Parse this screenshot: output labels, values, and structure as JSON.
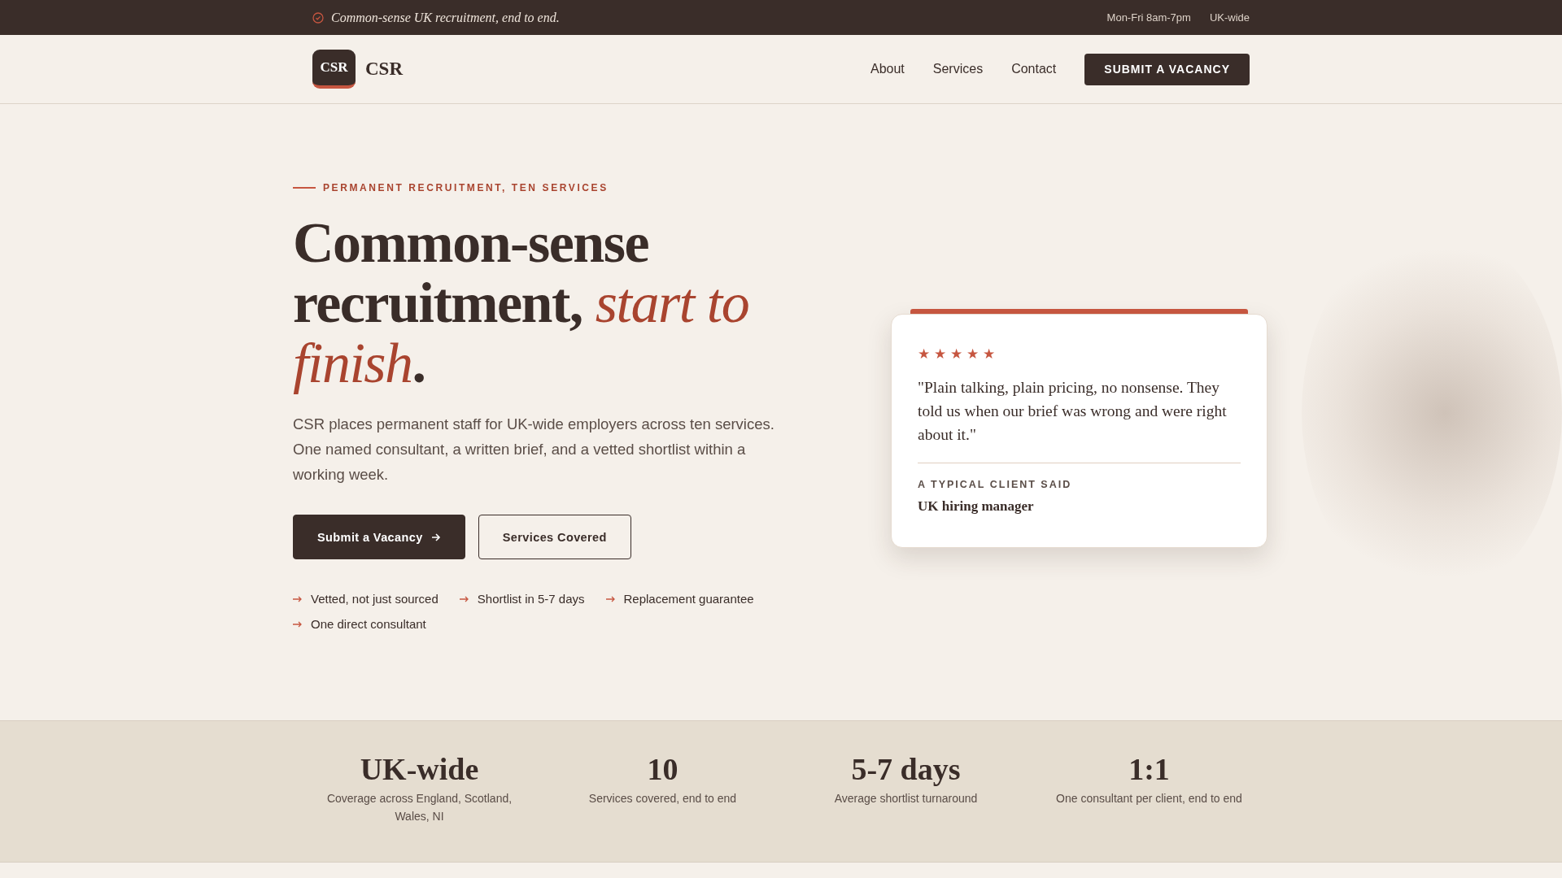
{
  "top_bar": {
    "tagline": "Common-sense UK recruitment, end to end.",
    "hours": "Mon-Fri 8am-7pm",
    "coverage": "UK-wide"
  },
  "nav": {
    "logo_badge": "CSR",
    "logo_text": "CSR",
    "links": [
      "About",
      "Services",
      "Contact"
    ],
    "cta": "SUBMIT A VACANCY"
  },
  "hero": {
    "eyebrow": "PERMANENT RECRUITMENT, TEN SERVICES",
    "headline": "Common-sense recruitment, *start to finish*.",
    "intro": "CSR places permanent staff for UK-wide employers across ten services. One named consultant, a written brief, and a vetted shortlist within a working week.",
    "buttons": [
      {
        "label": "Submit a Vacancy",
        "kind": "primary"
      },
      {
        "label": "Services Covered",
        "kind": "secondary"
      }
    ],
    "points": [
      "Vetted, not just sourced",
      "Shortlist in 5-7 days",
      "Replacement guarantee",
      "One direct consultant"
    ]
  },
  "testimonial": {
    "stars": 5,
    "quote": "\"Plain talking, plain pricing, no nonsense. They told us when our brief was wrong and were right about it.\"",
    "label": "A TYPICAL CLIENT SAID",
    "author": "UK hiring manager"
  },
  "stats": [
    {
      "value": "UK-wide",
      "caption": "Coverage across England, Scotland, Wales, NI"
    },
    {
      "value": "10",
      "caption": "Services covered, end to end"
    },
    {
      "value": "5-7 days",
      "caption": "Average shortlist turnaround"
    },
    {
      "value": "1:1",
      "caption": "One consultant per client, end to end"
    }
  ]
}
